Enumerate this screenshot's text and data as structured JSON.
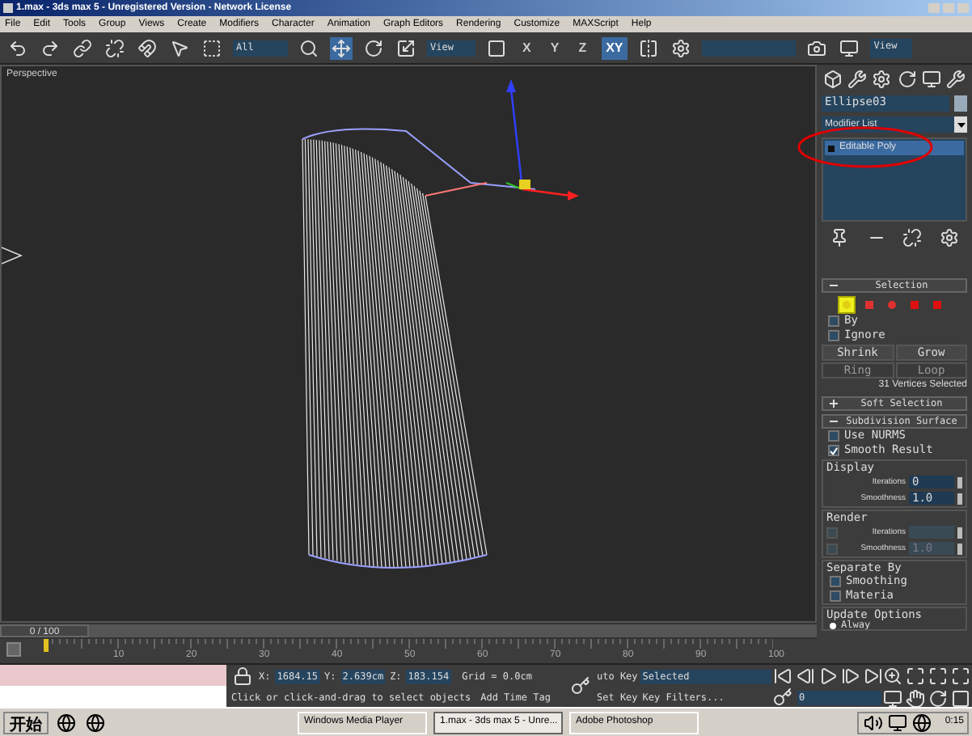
{
  "window": {
    "title": "1.max - 3ds max 5 - Unregistered Version - Network License"
  },
  "menu": [
    "File",
    "Edit",
    "Tools",
    "Group",
    "Views",
    "Create",
    "Modifiers",
    "Character",
    "Animation",
    "Graph Editors",
    "Rendering",
    "Customize",
    "MAXScript",
    "Help"
  ],
  "toolbar": {
    "selection_filter": "All",
    "reference_coord": "View",
    "axes": [
      {
        "label": "X",
        "selected": false
      },
      {
        "label": "Y",
        "selected": false
      },
      {
        "label": "Z",
        "selected": false
      },
      {
        "label": "XY",
        "selected": true
      }
    ],
    "view_label": "View"
  },
  "viewport": {
    "label": "Perspective"
  },
  "command_panel": {
    "object_name": "Ellipse03",
    "modifier_list": "Modifier List",
    "stack": [
      {
        "label": "Editable Poly",
        "selected": true
      }
    ],
    "selection": {
      "title": "Selection",
      "expanded": true,
      "subobjects": [
        {
          "kind": "vertex",
          "selected": true
        },
        {
          "kind": "edge",
          "selected": false
        },
        {
          "kind": "border",
          "selected": false
        },
        {
          "kind": "polygon",
          "selected": false
        },
        {
          "kind": "element",
          "selected": false
        }
      ],
      "by": {
        "label": "By",
        "checked": false
      },
      "ignore": {
        "label": "Ignore",
        "checked": false
      },
      "buttons": [
        {
          "label": "Shrink",
          "disabled": false
        },
        {
          "label": "Grow",
          "disabled": false
        },
        {
          "label": "Ring",
          "disabled": true
        },
        {
          "label": "Loop",
          "disabled": true
        }
      ],
      "status": "31 Vertices Selected"
    },
    "soft_selection": {
      "title": "Soft Selection",
      "expanded": false
    },
    "subdivision": {
      "title": "Subdivision Surface",
      "expanded": true,
      "options": [
        {
          "label": "Use NURMS",
          "checked": false
        },
        {
          "label": "Smooth Result",
          "checked": true
        }
      ],
      "display": {
        "title": "Display",
        "fields": [
          {
            "label": "Iterations",
            "value": "0"
          },
          {
            "label": "Smoothness",
            "value": "1.0"
          }
        ]
      },
      "render": {
        "title": "Render",
        "fields": [
          {
            "label": "Iterations",
            "checked": false,
            "disabled": true
          },
          {
            "label": "Smoothness",
            "value": "1.0",
            "checked": false,
            "disabled": true
          }
        ]
      },
      "separate_by": {
        "title": "Separate By",
        "options": [
          {
            "label": "Smoothing",
            "checked": false
          },
          {
            "label": "Materia",
            "checked": false
          }
        ]
      },
      "update_options": {
        "title": "Update Options",
        "options": [
          {
            "label": "Alway",
            "selected": true
          }
        ]
      }
    }
  },
  "timeline": {
    "frame": "0 / 100",
    "level": 0,
    "ruler_labels": [
      "10",
      "20",
      "30",
      "40",
      "50",
      "60",
      "70",
      "80",
      "90",
      "100"
    ]
  },
  "status": {
    "coords": [
      {
        "axis": "X:",
        "value": "1684.15"
      },
      {
        "axis": "Y:",
        "value": "2.639cm"
      },
      {
        "axis": "Z:",
        "value": "183.154"
      }
    ],
    "grid": "Grid = 0.0cm",
    "prompt": "Click or click-and-drag to select objects",
    "add_time_tag": "Add Time Tag",
    "auto_key": "uto Key",
    "key_mode": "Selected",
    "set_key": "Set Key",
    "key_filters": "Key Filters...",
    "current_frame": "0"
  },
  "taskbar": {
    "start": "开始",
    "tasks": [
      {
        "label": "Windows Media Player",
        "selected": false
      },
      {
        "label": "1.max - 3ds max 5 - Unre...",
        "selected": true
      },
      {
        "label": "Adobe Photoshop",
        "selected": false
      }
    ],
    "clock": "0:15"
  }
}
